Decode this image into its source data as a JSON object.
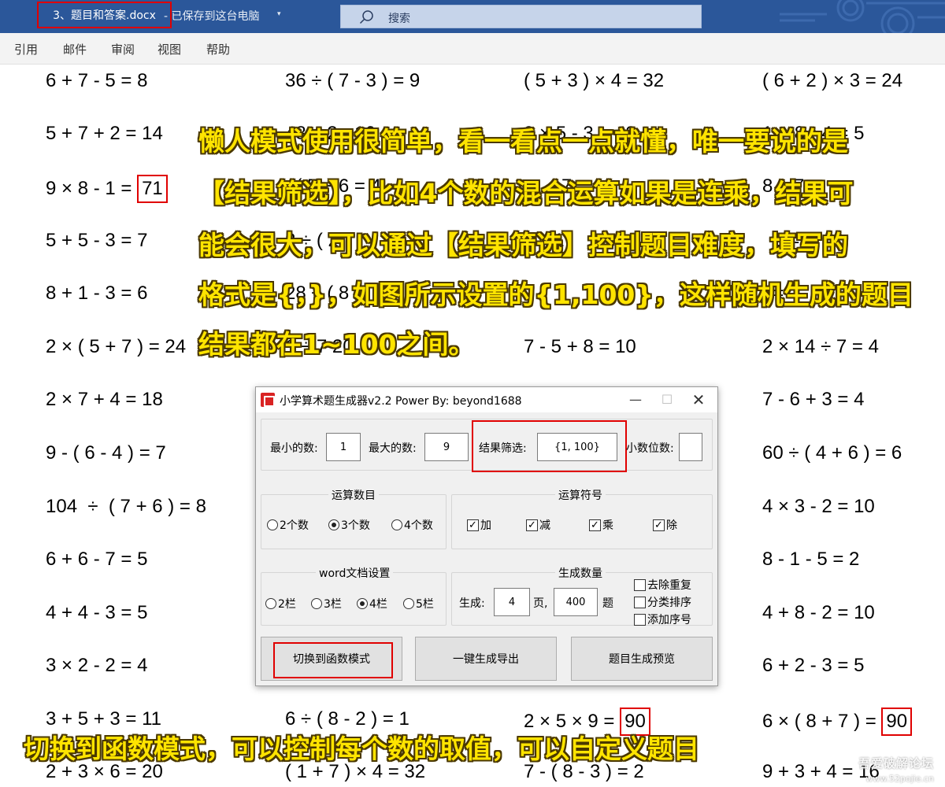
{
  "titlebar": {
    "doc_title": "3、题目和答案.docx",
    "doc_status": "-  已保存到这台电脑",
    "status_chevron": "▾",
    "search_placeholder": "搜索"
  },
  "ribbon": {
    "tabs": [
      "引用",
      "邮件",
      "审阅",
      "视图",
      "帮助"
    ]
  },
  "document": {
    "equations": {
      "col1": [
        "6 + 7 - 5 = 8",
        "5 + 7 + 2 = 14",
        "9 × 8 - 1 = ",
        "5 + 5 - 3 = 7",
        "8 + 1 - 3 = 6",
        "2 × ( 5 + 7 ) = 24",
        "2 × 7 + 4 = 18",
        "9 - ( 6 - 4 ) = 7",
        "104  ÷  ( 7 + 6 ) = 8",
        "6 + 6 - 7 = 5",
        "4 + 4 - 3 = 5",
        "3 × 2 - 2 = 4",
        "3 + 5 + 3 = 11",
        "2 + 3 × 6 = 20"
      ],
      "col1_boxed_answer": "71",
      "col2": [
        "36 ÷ ( 7 - 3 ) = 9",
        "48 ÷ 2 - 16",
        "  ( 5 ÷ 6 = 4",
        "2 ÷ ( 2",
        "28 ÷ ( 8",
        "1 ÷ 7 20",
        "6 ÷ ( 8 - 2 ) = 1",
        "( 1 + 7 ) × 4 = 32"
      ],
      "col3": [
        "( 5 + 3 ) × 4 = 32",
        "9 × 5 - 3 = 42",
        "     - 7",
        "    11",
        "7 - 5 + 8 = 10",
        "2 × 5 × 9 = ",
        "7 - ( 8 - 3 ) = 2"
      ],
      "col3_boxed_answer": "90",
      "col4": [
        "( 6 + 2 ) × 3 = 24",
        "1 + 8 - 4 = 5",
        "8 ÷ 7",
        "  5 =",
        "  =",
        "2 × 14 ÷ 7 = 4",
        "7 - 6 + 3 = 4",
        "60 ÷ ( 4 + 6 ) = 6",
        "4 × 3 - 2 = 10",
        "8 - 1 - 5 = 2",
        "4 + 8 - 2 = 10",
        "6 + 2 - 3 = 5",
        "6 × ( 8 + 7 ) = ",
        "9 + 3 + 4 = 16"
      ],
      "col4_boxed_answer": "90"
    }
  },
  "annotations": {
    "top_lines": [
      "懒人模式使用很简单，看一看点一点就懂，唯一要说的是",
      "【结果筛选】，比如4个数的混合运算如果是连乘，结果可",
      "能会很大，可以通过【结果筛选】控制题目难度，填写的",
      "格式是{，}，如图所示设置的{1,100}，这样随机生成的题目",
      "结果都在1~100之间。"
    ],
    "bottom_line": "切换到函数模式，可以控制每个数的取值，可以自定义题目"
  },
  "dialog": {
    "title": "小学算术题生成器v2.2  Power By:  beyond1688",
    "min_label": "最小的数:",
    "min_value": "1",
    "max_label": "最大的数:",
    "max_value": "9",
    "filter_label": "结果筛选:",
    "filter_value": "{1, 100}",
    "decimal_label": "小数位数:",
    "decimal_value": "",
    "count_group_label": "运算数目",
    "count_options": [
      "2个数",
      "3个数",
      "4个数"
    ],
    "count_selected": "3个数",
    "ops_group_label": "运算符号",
    "ops": [
      {
        "label": "加",
        "checked": true
      },
      {
        "label": "减",
        "checked": true
      },
      {
        "label": "乘",
        "checked": true
      },
      {
        "label": "除",
        "checked": true
      }
    ],
    "word_group_label": "word文档设置",
    "col_options": [
      "2栏",
      "3栏",
      "4栏",
      "5栏"
    ],
    "col_selected": "4栏",
    "gen_group_label": "生成数量",
    "gen_label": "生成:",
    "pages_value": "4",
    "pages_unit": "页,",
    "questions_value": "400",
    "questions_unit": "题",
    "option_checks": [
      {
        "label": "去除重复",
        "checked": false
      },
      {
        "label": "分类排序",
        "checked": false
      },
      {
        "label": "添加序号",
        "checked": false
      }
    ],
    "switch_button": "切换到函数模式",
    "export_button": "一键生成导出",
    "preview_button": "题目生成预览"
  },
  "watermark": {
    "line1": "吾爱破解论坛",
    "line2": "www.52pojie.cn"
  },
  "colors": {
    "titlebar": "#2b579a",
    "highlight_red": "#e00000",
    "annotation_yellow": "#ffe400"
  }
}
